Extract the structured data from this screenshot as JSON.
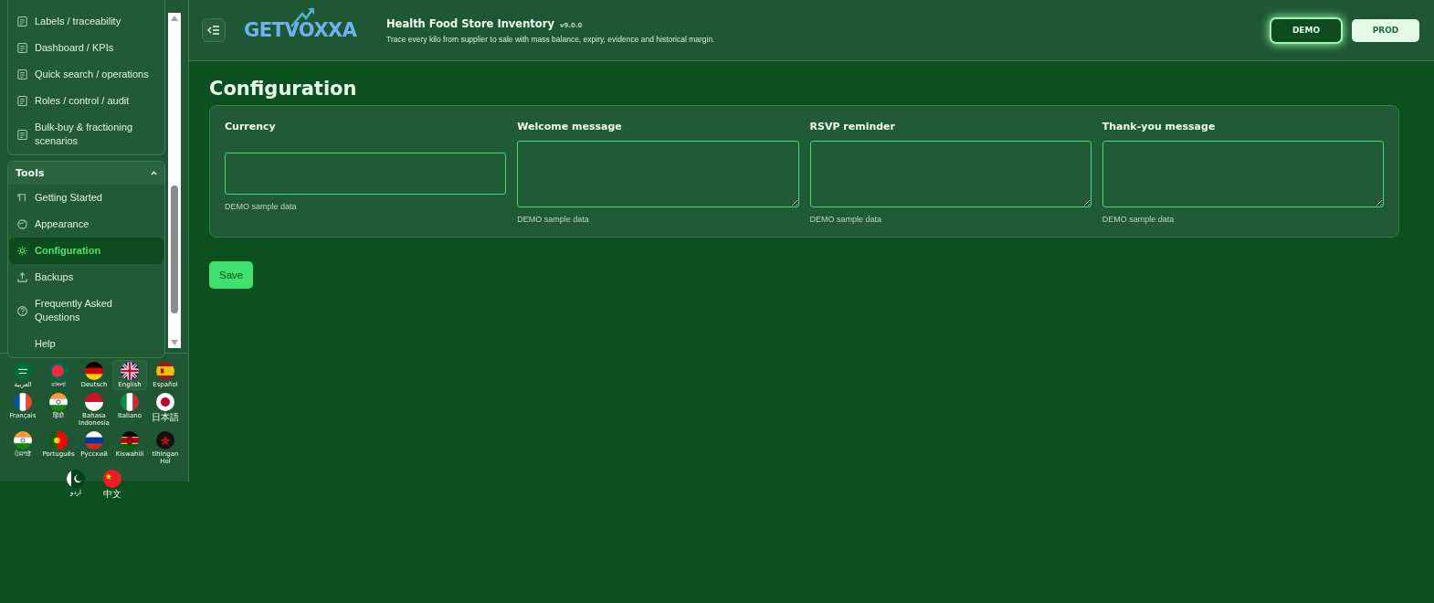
{
  "sidebar": {
    "groups": [
      {
        "items": [
          {
            "label": "Labels / traceability",
            "selected": false
          },
          {
            "label": "Dashboard / KPIs",
            "selected": false
          },
          {
            "label": "Quick search / operations",
            "selected": false
          },
          {
            "label": "Roles / control / audit",
            "selected": false
          },
          {
            "label": "Bulk-buy & fractioning scenarios",
            "selected": false
          }
        ]
      },
      {
        "title": "Tools",
        "expanded": true,
        "items": [
          {
            "label": "Getting Started",
            "selected": false
          },
          {
            "label": "Appearance",
            "selected": false
          },
          {
            "label": "Configuration",
            "selected": true
          },
          {
            "label": "Backups",
            "selected": false
          },
          {
            "label": "Frequently Asked Questions",
            "selected": false
          },
          {
            "label": "Help",
            "selected": false
          }
        ]
      }
    ]
  },
  "languages": [
    {
      "label": "العربية",
      "selected": false
    },
    {
      "label": "বাংলা",
      "selected": false
    },
    {
      "label": "Deutsch",
      "selected": false
    },
    {
      "label": "English",
      "selected": true
    },
    {
      "label": "Español",
      "selected": false
    },
    {
      "label": "Français",
      "selected": false
    },
    {
      "label": "हिंदी",
      "selected": false
    },
    {
      "label": "Bahasa Indonesia",
      "selected": false
    },
    {
      "label": "Italiano",
      "selected": false
    },
    {
      "label": "日本語",
      "selected": false
    },
    {
      "label": "ਪੰਜਾਬੀ",
      "selected": false
    },
    {
      "label": "Português",
      "selected": false
    },
    {
      "label": "Русский",
      "selected": false
    },
    {
      "label": "Kiswahili",
      "selected": false
    },
    {
      "label": "tlhIngan Hol",
      "selected": false
    },
    {
      "label": "اردو",
      "selected": false
    },
    {
      "label": "中文",
      "selected": false
    }
  ],
  "header": {
    "logo": "GETVOXXA",
    "title": "Health Food Store Inventory",
    "version": "v9.0.0",
    "subtitle": "Trace every kilo from supplier to sale with mass balance, expiry, evidence and historical margin."
  },
  "env_buttons": [
    {
      "label": "DEMO",
      "selected": true
    },
    {
      "label": "PROD",
      "selected": false
    }
  ],
  "page": {
    "title": "Configuration",
    "fields": [
      {
        "kind": "input",
        "label": "Currency",
        "hint": "DEMO sample data"
      },
      {
        "kind": "textarea",
        "label": "Welcome message",
        "hint": "DEMO sample data"
      },
      {
        "kind": "textarea",
        "label": "RSVP reminder",
        "hint": "DEMO sample data"
      },
      {
        "kind": "textarea",
        "label": "Thank-you message",
        "hint": "DEMO sample data"
      }
    ],
    "save_button": "Save"
  }
}
